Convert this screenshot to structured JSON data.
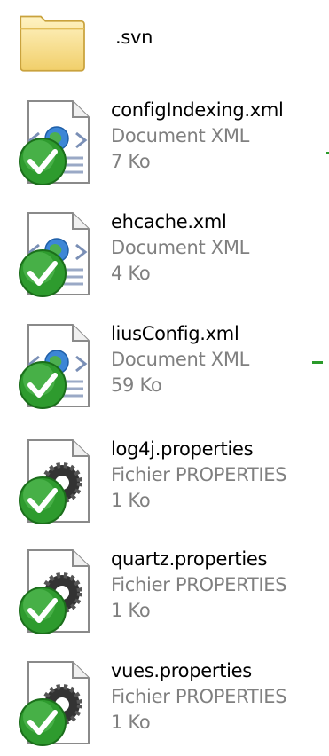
{
  "folder": {
    "name": ".svn",
    "icon": "folder-icon"
  },
  "files": [
    {
      "name": "configIndexing.xml",
      "type": "Document XML",
      "size": "7 Ko",
      "icon": "xml-document-icon",
      "overlay": "svn-ok-check-icon"
    },
    {
      "name": "ehcache.xml",
      "type": "Document XML",
      "size": "4 Ko",
      "icon": "xml-document-icon",
      "overlay": "svn-ok-check-icon"
    },
    {
      "name": "liusConfig.xml",
      "type": "Document XML",
      "size": "59 Ko",
      "icon": "xml-document-icon",
      "overlay": "svn-ok-check-icon"
    },
    {
      "name": "log4j.properties",
      "type": "Fichier PROPERTIES",
      "size": "1 Ko",
      "icon": "properties-file-icon",
      "overlay": "svn-ok-check-icon"
    },
    {
      "name": "quartz.properties",
      "type": "Fichier PROPERTIES",
      "size": "1 Ko",
      "icon": "properties-file-icon",
      "overlay": "svn-ok-check-icon"
    },
    {
      "name": "vues.properties",
      "type": "Fichier PROPERTIES",
      "size": "1 Ko",
      "icon": "properties-file-icon",
      "overlay": "svn-ok-check-icon"
    }
  ],
  "colors": {
    "check_green": "#2a9a2a",
    "secondary_text": "#808080",
    "folder_yellow": "#f7d774"
  }
}
